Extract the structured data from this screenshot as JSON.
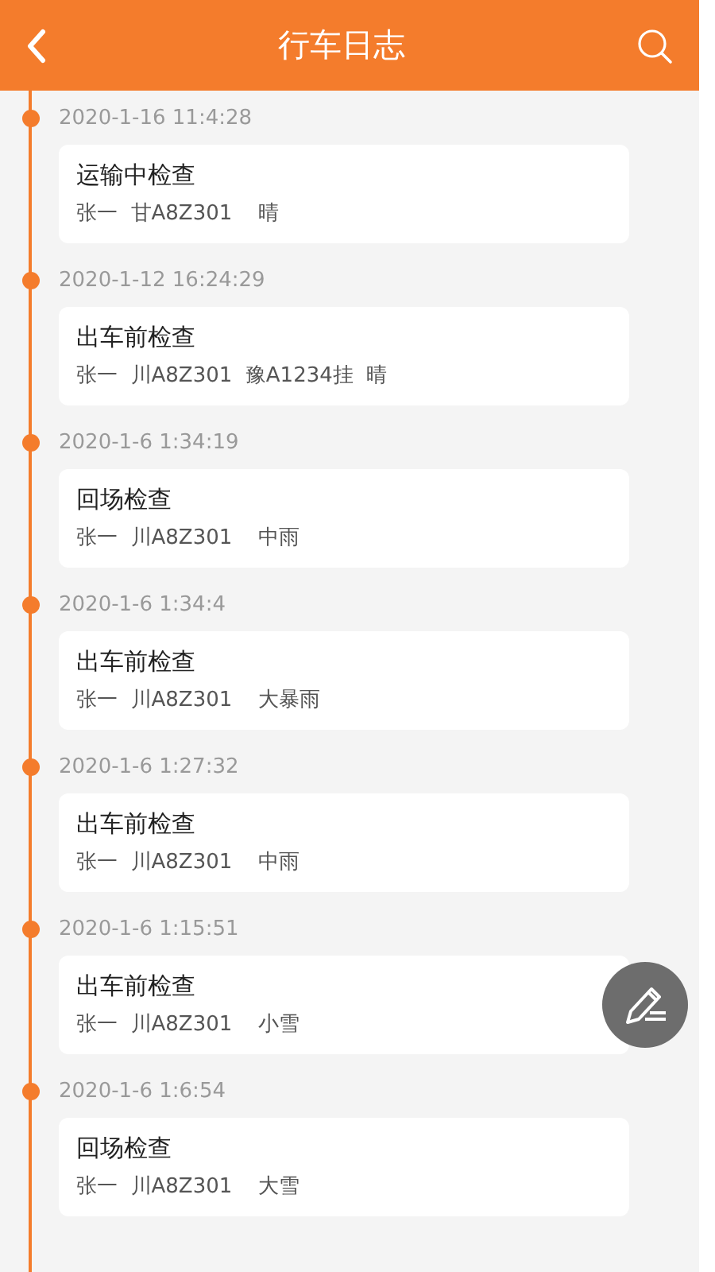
{
  "header": {
    "title": "行车日志"
  },
  "entries": [
    {
      "time": "2020-1-16 11:4:28",
      "title": "运输中检查",
      "detail": "张一  甘A8Z301    晴"
    },
    {
      "time": "2020-1-12 16:24:29",
      "title": "出车前检查",
      "detail": "张一  川A8Z301  豫A1234挂  晴"
    },
    {
      "time": "2020-1-6 1:34:19",
      "title": "回场检查",
      "detail": "张一  川A8Z301    中雨"
    },
    {
      "time": "2020-1-6 1:34:4",
      "title": "出车前检查",
      "detail": "张一  川A8Z301    大暴雨"
    },
    {
      "time": "2020-1-6 1:27:32",
      "title": "出车前检查",
      "detail": "张一  川A8Z301    中雨"
    },
    {
      "time": "2020-1-6 1:15:51",
      "title": "出车前检查",
      "detail": "张一  川A8Z301    小雪"
    },
    {
      "time": "2020-1-6 1:6:54",
      "title": "回场检查",
      "detail": "张一  川A8Z301    大雪"
    }
  ]
}
